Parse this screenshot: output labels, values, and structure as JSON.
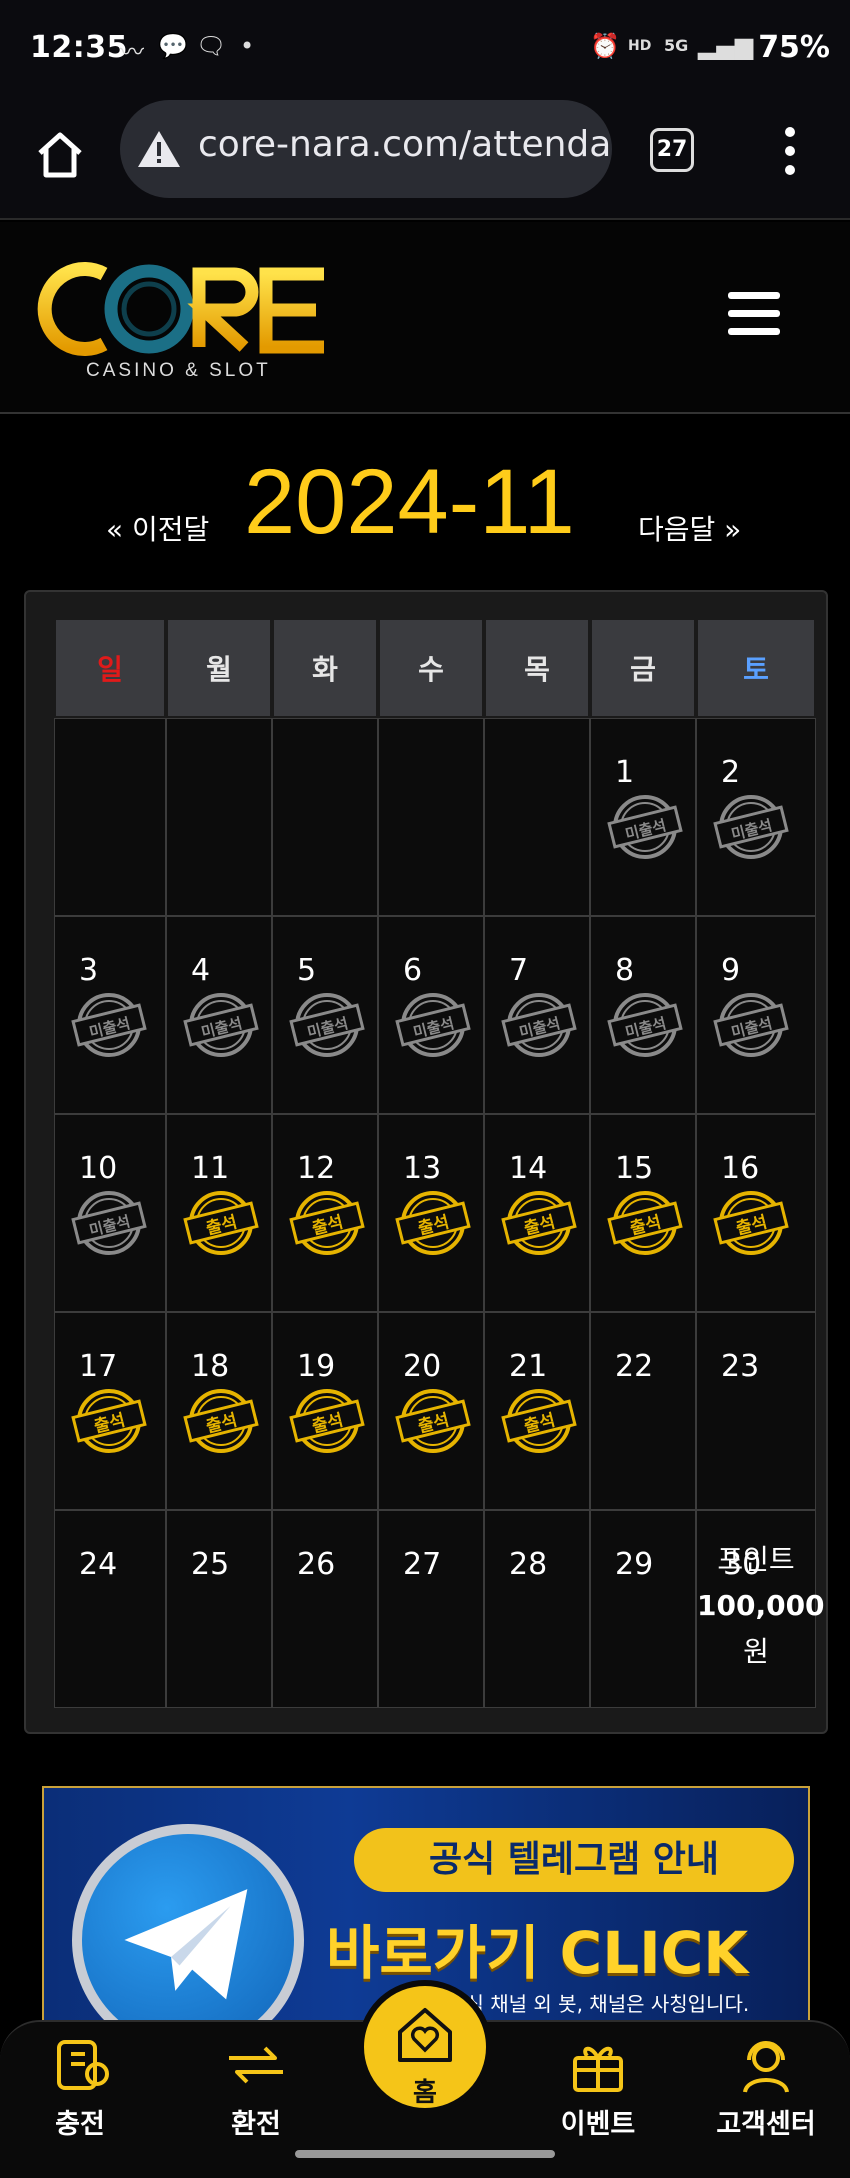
{
  "status_bar": {
    "time": "12:35",
    "battery": "75%",
    "network": "5G"
  },
  "browser": {
    "url": "core-nara.com/attendance",
    "tab_count": "27"
  },
  "site": {
    "logo_text": "CORE",
    "logo_sub": "CASINO & SLOT"
  },
  "calendar": {
    "prev_label": "« 이전달",
    "next_label": "다음달 »",
    "month": "2024-11",
    "weekdays": [
      "일",
      "월",
      "화",
      "수",
      "목",
      "금",
      "토"
    ],
    "stamp_present": "출석",
    "stamp_absent": "미출석",
    "weeks": [
      [
        {
          "d": ""
        },
        {
          "d": ""
        },
        {
          "d": ""
        },
        {
          "d": ""
        },
        {
          "d": ""
        },
        {
          "d": "1",
          "s": "absent"
        },
        {
          "d": "2",
          "s": "absent"
        }
      ],
      [
        {
          "d": "3",
          "s": "absent"
        },
        {
          "d": "4",
          "s": "absent"
        },
        {
          "d": "5",
          "s": "absent"
        },
        {
          "d": "6",
          "s": "absent"
        },
        {
          "d": "7",
          "s": "absent"
        },
        {
          "d": "8",
          "s": "absent"
        },
        {
          "d": "9",
          "s": "absent"
        }
      ],
      [
        {
          "d": "10",
          "s": "absent"
        },
        {
          "d": "11",
          "s": "present"
        },
        {
          "d": "12",
          "s": "present"
        },
        {
          "d": "13",
          "s": "present"
        },
        {
          "d": "14",
          "s": "present"
        },
        {
          "d": "15",
          "s": "present"
        },
        {
          "d": "16",
          "s": "present"
        }
      ],
      [
        {
          "d": "17",
          "s": "present"
        },
        {
          "d": "18",
          "s": "present"
        },
        {
          "d": "19",
          "s": "present"
        },
        {
          "d": "20",
          "s": "present"
        },
        {
          "d": "21",
          "s": "present"
        },
        {
          "d": "22"
        },
        {
          "d": "23"
        }
      ],
      [
        {
          "d": "24"
        },
        {
          "d": "25"
        },
        {
          "d": "26"
        },
        {
          "d": "27"
        },
        {
          "d": "28"
        },
        {
          "d": "29"
        },
        {
          "d": "30",
          "reward": [
            "포인트",
            "100,000",
            "원"
          ]
        }
      ]
    ]
  },
  "banner": {
    "title": "공식 텔레그램 안내",
    "cta": "바로가기 CLICK",
    "note": "※ 공식 채널 외 봇, 채널은 사칭입니다."
  },
  "bottom_nav": {
    "charge": "충전",
    "exchange": "환전",
    "home": "홈",
    "event": "이벤트",
    "support": "고객센터"
  },
  "colors": {
    "accent": "#ffcc1a",
    "sunday": "#e01a1a",
    "saturday": "#5aa0ff"
  }
}
